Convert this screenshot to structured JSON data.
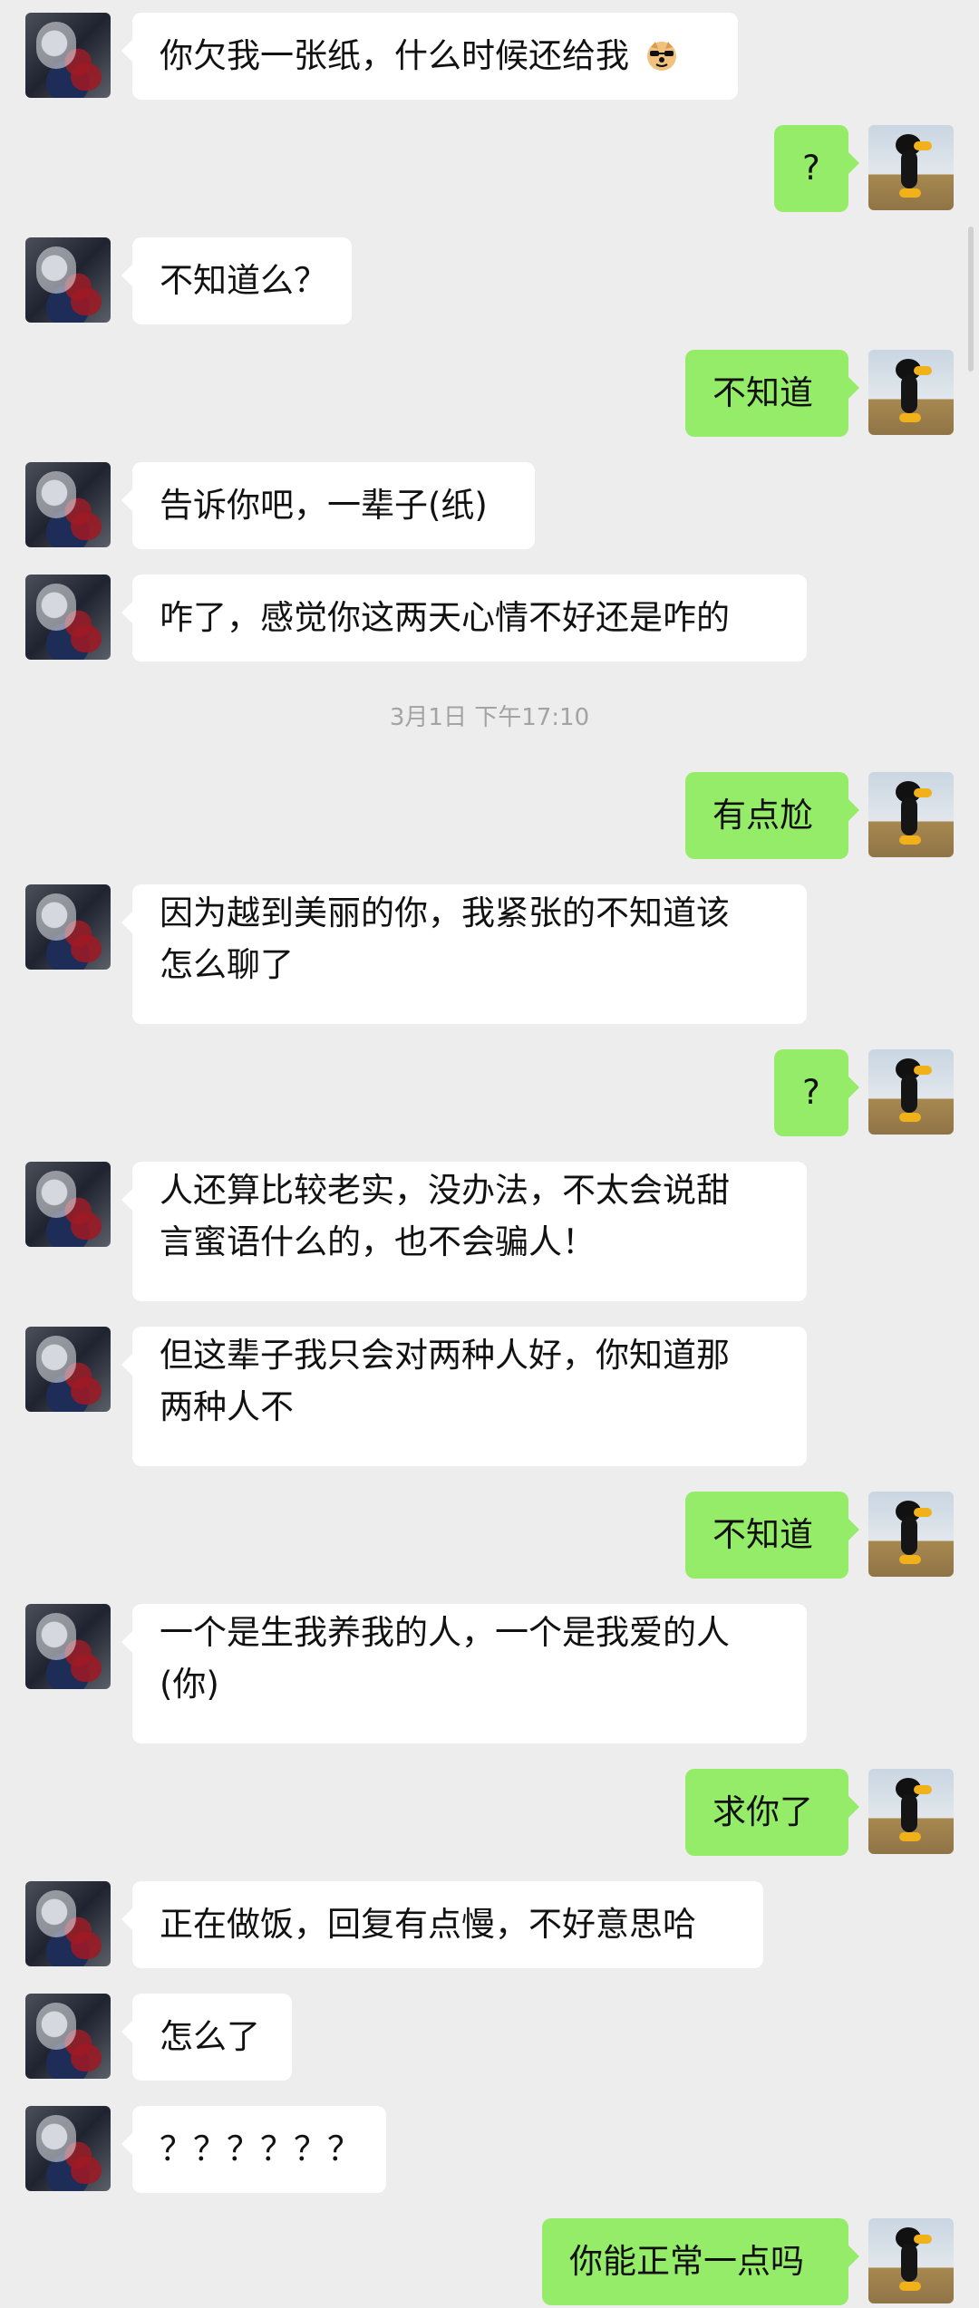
{
  "chat": {
    "timestamp": "3月1日 下午17:10",
    "messages": [
      {
        "side": "left",
        "text": "你欠我一张纸，什么时候还给我",
        "emoji": "doge-emoji"
      },
      {
        "side": "right",
        "text": "?"
      },
      {
        "side": "left",
        "text": "不知道么？"
      },
      {
        "side": "right",
        "text": "不知道"
      },
      {
        "side": "left",
        "text": "告诉你吧，一辈子(纸)"
      },
      {
        "side": "left",
        "text": "咋了，感觉你这两天心情不好还是咋的"
      },
      {
        "side": "right",
        "text": "有点尬"
      },
      {
        "side": "left",
        "line1": "因为越到美丽的你，我紧张的不知道该",
        "line2": "怎么聊了"
      },
      {
        "side": "right",
        "text": "?"
      },
      {
        "side": "left",
        "line1": "人还算比较老实，没办法，不太会说甜",
        "line2": "言蜜语什么的，也不会骗人！"
      },
      {
        "side": "left",
        "line1": "但这辈子我只会对两种人好，你知道那",
        "line2": "两种人不"
      },
      {
        "side": "right",
        "text": "不知道"
      },
      {
        "side": "left",
        "line1": "一个是生我养我的人，一个是我爱的人",
        "line2": "(你)"
      },
      {
        "side": "right",
        "text": "求你了"
      },
      {
        "side": "left",
        "text": "正在做饭，回复有点慢，不好意思哈"
      },
      {
        "side": "left",
        "text": "怎么了"
      },
      {
        "side": "left",
        "text": "？？？？？？"
      },
      {
        "side": "right",
        "text": "你能正常一点吗"
      }
    ]
  },
  "colors": {
    "background": "#ededed",
    "left_bubble": "#ffffff",
    "right_bubble": "#95ec69",
    "timestamp": "#a3a3a3"
  }
}
